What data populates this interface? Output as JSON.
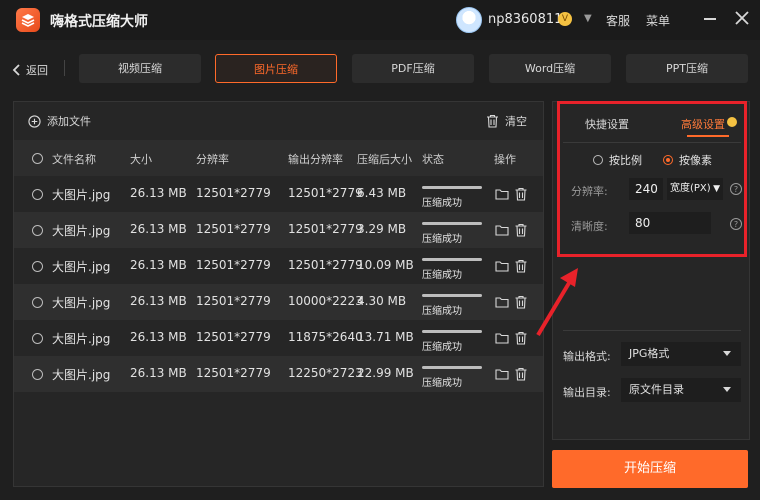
{
  "app": {
    "title": "嗨格式压缩大师"
  },
  "user": {
    "name": "np8360811",
    "vip_mark": "V"
  },
  "topbar": {
    "service": "客服",
    "menu": "菜单"
  },
  "nav": {
    "back": "返回",
    "tabs": [
      {
        "label": "视频压缩",
        "active": false
      },
      {
        "label": "图片压缩",
        "active": true
      },
      {
        "label": "PDF压缩",
        "active": false
      },
      {
        "label": "Word压缩",
        "active": false
      },
      {
        "label": "PPT压缩",
        "active": false
      }
    ]
  },
  "toolbar": {
    "add_file": "添加文件",
    "clear": "清空"
  },
  "table": {
    "headers": [
      "文件名称",
      "大小",
      "分辨率",
      "输出分辨率",
      "压缩后大小",
      "状态",
      "操作"
    ],
    "rows": [
      {
        "name": "大图片.jpg",
        "size": "26.13 MB",
        "resolution": "12501*2779",
        "out_resolution": "12501*2779",
        "out_size": "6.43 MB",
        "status": "压缩成功",
        "progress": 1.0
      },
      {
        "name": "大图片.jpg",
        "size": "26.13 MB",
        "resolution": "12501*2779",
        "out_resolution": "12501*2779",
        "out_size": "3.29 MB",
        "status": "压缩成功",
        "progress": 1.0
      },
      {
        "name": "大图片.jpg",
        "size": "26.13 MB",
        "resolution": "12501*2779",
        "out_resolution": "12501*2779",
        "out_size": "10.09 MB",
        "status": "压缩成功",
        "progress": 1.0
      },
      {
        "name": "大图片.jpg",
        "size": "26.13 MB",
        "resolution": "12501*2779",
        "out_resolution": "10000*2223",
        "out_size": "4.30 MB",
        "status": "压缩成功",
        "progress": 1.0
      },
      {
        "name": "大图片.jpg",
        "size": "26.13 MB",
        "resolution": "12501*2779",
        "out_resolution": "11875*2640",
        "out_size": "13.71 MB",
        "status": "压缩成功",
        "progress": 1.0
      },
      {
        "name": "大图片.jpg",
        "size": "26.13 MB",
        "resolution": "12501*2779",
        "out_resolution": "12250*2723",
        "out_size": "22.99 MB",
        "status": "压缩成功",
        "progress": 1.0
      }
    ]
  },
  "settings": {
    "tab_quick": "快捷设置",
    "tab_advanced": "高级设置",
    "mode_ratio": "按比例",
    "mode_pixel": "按像素",
    "resolution_label": "分辨率:",
    "resolution_value": "240",
    "resolution_unit": "宽度(PX)",
    "clarity_label": "清晰度:",
    "clarity_value": "80",
    "output_format_label": "输出格式:",
    "output_format_value": "JPG格式",
    "output_dir_label": "输出目录:",
    "output_dir_value": "原文件目录"
  },
  "start_button": "开始压缩",
  "colors": {
    "accent": "#ff6a2a",
    "annotation": "#e8222a",
    "background": "#1f1f1f"
  }
}
